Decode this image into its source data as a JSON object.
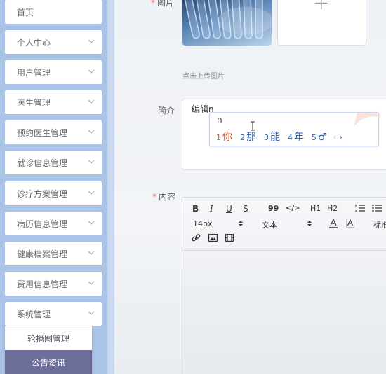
{
  "sidebar": {
    "items": [
      {
        "label": "首页",
        "has_arrow": false
      },
      {
        "label": "个人中心",
        "has_arrow": true
      },
      {
        "label": "用户管理",
        "has_arrow": true
      },
      {
        "label": "医生管理",
        "has_arrow": true
      },
      {
        "label": "预约医生管理",
        "has_arrow": true
      },
      {
        "label": "就诊信息管理",
        "has_arrow": true
      },
      {
        "label": "诊疗方案管理",
        "has_arrow": true
      },
      {
        "label": "病历信息管理",
        "has_arrow": true
      },
      {
        "label": "健康档案管理",
        "has_arrow": true
      },
      {
        "label": "费用信息管理",
        "has_arrow": true
      },
      {
        "label": "系统管理",
        "has_arrow": true
      }
    ],
    "submenu": [
      {
        "label": "轮播图管理",
        "active": false
      },
      {
        "label": "公告资讯",
        "active": true
      }
    ]
  },
  "form": {
    "image_label": "图片",
    "upload_plus": "+",
    "upload_hint": "点击上传图片",
    "intro_label": "简介",
    "intro_value": "编辑n",
    "content_label": "内容",
    "required_mark": "*"
  },
  "ime": {
    "input": "n",
    "candidates": [
      {
        "num": "1",
        "text": "你"
      },
      {
        "num": "2",
        "text": "那"
      },
      {
        "num": "3",
        "text": "能"
      },
      {
        "num": "4",
        "text": "年"
      },
      {
        "num": "5",
        "text": "♂"
      }
    ],
    "prev": "‹",
    "next": "›"
  },
  "editor": {
    "toolbar_row1": [
      "B",
      "I",
      "U",
      "S",
      "99",
      "</>",
      "H1",
      "H2"
    ],
    "font_size": "14px",
    "font_type": "文本",
    "heading_select": "标准"
  },
  "colors": {
    "sidebar_bg": "#a9c4e6",
    "active_submenu": "#6d6f9a",
    "required": "#f56c6c",
    "ime_first": "#e0502a",
    "ime_candidate": "#2b62b2"
  }
}
